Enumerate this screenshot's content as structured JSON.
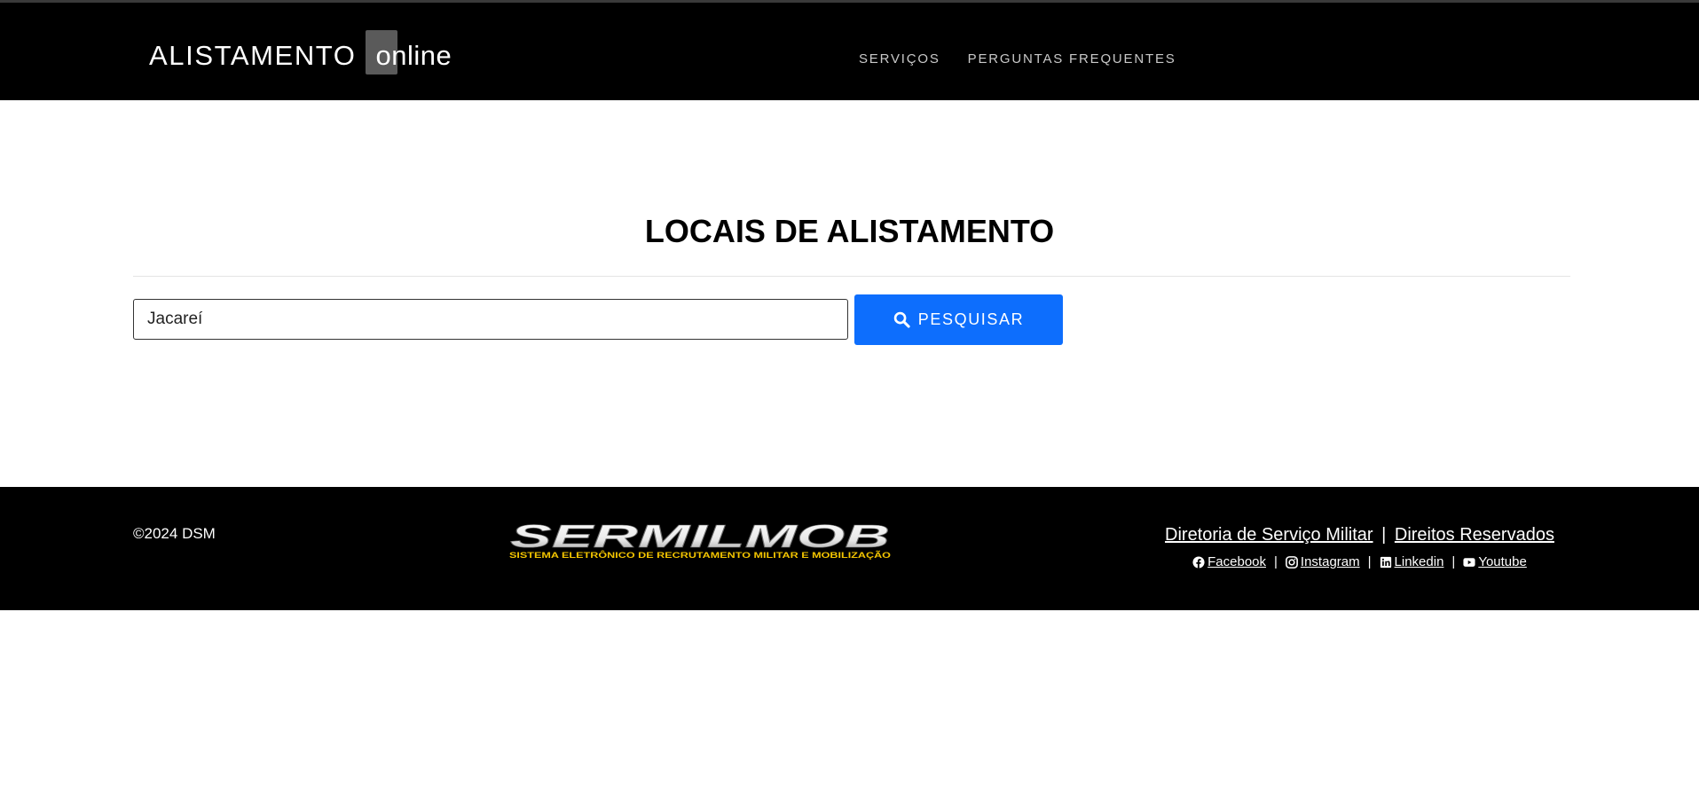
{
  "header": {
    "brand_main": "ALISTAMENTO",
    "brand_suffix": "online",
    "nav": [
      {
        "label": "SERVIÇOS"
      },
      {
        "label": "PERGUNTAS FREQUENTES"
      }
    ]
  },
  "main": {
    "title": "LOCAIS DE ALISTAMENTO",
    "search": {
      "value": "Jacareí",
      "placeholder": ""
    },
    "search_button_label": "PESQUISAR",
    "search_icon": "search-icon"
  },
  "footer": {
    "copyright": "©2024 DSM",
    "logo_text": "SERMILMOB",
    "logo_subtitle": "SISTEMA ELETRÔNICO DE RECRUTAMENTO MILITAR E MOBILIZAÇÃO",
    "link_dsm": "Diretoria de Serviço Militar",
    "link_rights": "Direitos Reservados",
    "separator": "|",
    "social": [
      {
        "label": "Facebook",
        "icon": "facebook-icon"
      },
      {
        "label": "Instagram",
        "icon": "instagram-icon"
      },
      {
        "label": "Linkedin",
        "icon": "linkedin-icon"
      },
      {
        "label": "Youtube",
        "icon": "youtube-icon"
      }
    ]
  },
  "colors": {
    "nav_bg": "#000000",
    "accent": "#0d6efd",
    "logo_yellow": "#f2c400"
  }
}
